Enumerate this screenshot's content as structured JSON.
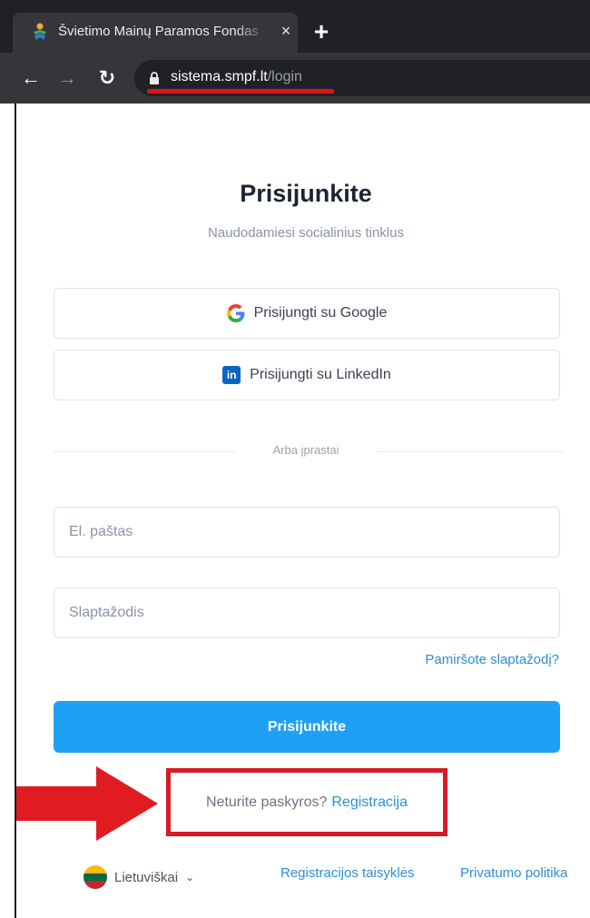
{
  "browser": {
    "tab_title": "Švietimo Mainų Paramos Fondas",
    "tab_close": "×",
    "new_tab": "+",
    "url_host": "sistema.smpf.lt",
    "url_path": "/login",
    "icons": [
      "back-arrow-icon",
      "forward-arrow-icon",
      "reload-icon",
      "lock-icon",
      "favicon-icon"
    ]
  },
  "login": {
    "title": "Prisijunkite",
    "subtitle": "Naudodamiesi socialinius tinklus",
    "google_label": "Prisijungti su Google",
    "linkedin_label": "Prisijungti su LinkedIn",
    "linkedin_icon_text": "in",
    "divider": "Arba įprastai",
    "email_placeholder": "El. paštas",
    "password_placeholder": "Slaptažodis",
    "forgot": "Pamiršote slaptažodį?",
    "submit": "Prisijunkite",
    "no_account": "Neturite paskyros?",
    "register": "Registracija"
  },
  "footer": {
    "language": "Lietuviškai",
    "rules": "Registracijos taisyklės",
    "privacy": "Privatumo politika"
  },
  "colors": {
    "primary": "#1ea1f4",
    "link": "#2c8ed6",
    "highlight": "#d81b24"
  }
}
